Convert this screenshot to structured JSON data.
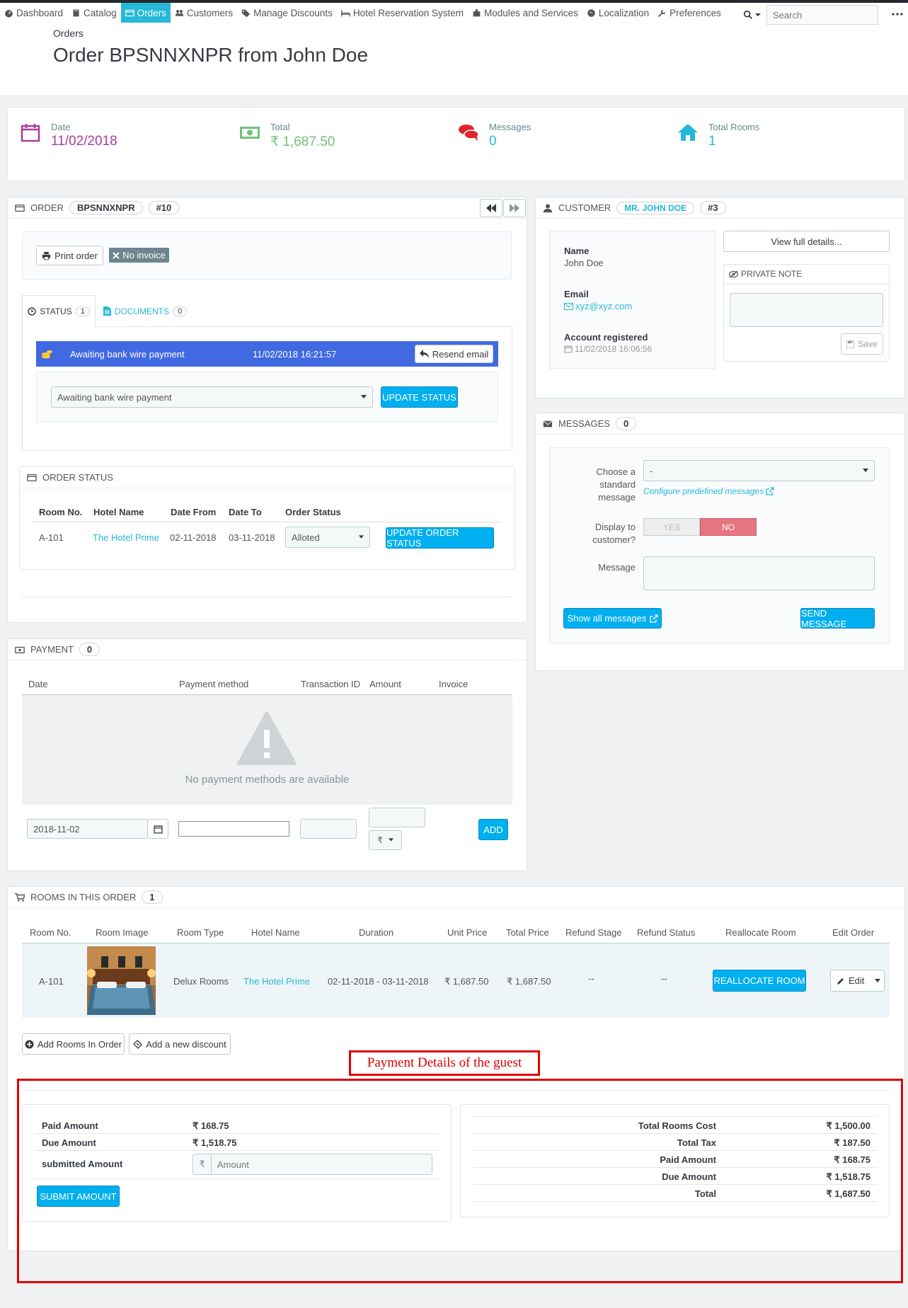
{
  "nav": {
    "items": [
      {
        "label": "Dashboard",
        "icon": "dashboard-icon"
      },
      {
        "label": "Catalog",
        "icon": "book-icon"
      },
      {
        "label": "Orders",
        "icon": "credit-card-icon",
        "active": true
      },
      {
        "label": "Customers",
        "icon": "users-icon"
      },
      {
        "label": "Manage Discounts",
        "icon": "tags-icon"
      },
      {
        "label": "Hotel Reservation System",
        "icon": "bed-icon"
      },
      {
        "label": "Modules and Services",
        "icon": "puzzle-icon"
      },
      {
        "label": "Localization",
        "icon": "globe-icon"
      },
      {
        "label": "Preferences",
        "icon": "wrench-icon"
      }
    ],
    "search_placeholder": "Search"
  },
  "header": {
    "breadcrumb": "Orders",
    "title": "Order BPSNNXNPR from John Doe"
  },
  "kpis": {
    "date": {
      "label": "Date",
      "value": "11/02/2018",
      "color": "#ab3e9d"
    },
    "total": {
      "label": "Total",
      "value": "₹ 1,687.50",
      "color": "#72c279"
    },
    "messages": {
      "label": "Messages",
      "value": "0",
      "color": "#25b9d7"
    },
    "rooms": {
      "label": "Total Rooms",
      "value": "1",
      "color": "#25b9d7"
    }
  },
  "order": {
    "label": "ORDER",
    "reference": "BPSNNXNPR",
    "id": "#10",
    "print_label": "Print order",
    "no_invoice_label": "No invoice",
    "tabs": {
      "status": {
        "label": "STATUS",
        "count": "1"
      },
      "documents": {
        "label": "DOCUMENTS",
        "count": "0"
      }
    },
    "history": {
      "status": "Awaiting bank wire payment",
      "date": "11/02/2018 16:21:57",
      "resend": "Resend email",
      "color": "#4169e1"
    },
    "status_select": "Awaiting bank wire payment",
    "update_status": "UPDATE STATUS"
  },
  "order_status": {
    "title": "ORDER STATUS",
    "columns": [
      "Room No.",
      "Hotel Name",
      "Date From",
      "Date To",
      "Order Status"
    ],
    "row": {
      "room": "A-101",
      "hotel": "The Hotel Prime",
      "from": "02-11-2018",
      "to": "03-11-2018",
      "status": "Alloted"
    },
    "update_button": "UPDATE ORDER STATUS"
  },
  "customer": {
    "label": "CUSTOMER",
    "name_badge": "MR. JOHN DOE",
    "id": "#3",
    "name_label": "Name",
    "name": "John  Doe",
    "email_label": "Email",
    "email": "xyz@xyz.com",
    "registered_label": "Account registered",
    "registered": "11/02/2018 16:06:56",
    "view_details": "View full details...",
    "private_note": "PRIVATE NOTE",
    "save": "Save"
  },
  "messages": {
    "label": "MESSAGES",
    "count": "0",
    "choose_label_1": "Choose a",
    "choose_label_2": "standard",
    "choose_label_3": "message",
    "choose_value": "-",
    "configure": "Configure predefined messages",
    "display_label_1": "Display to",
    "display_label_2": "customer?",
    "yes": "YES",
    "no": "NO",
    "message_label": "Message",
    "show_all": "Show all messages",
    "send": "SEND MESSAGE"
  },
  "payment": {
    "label": "PAYMENT",
    "count": "0",
    "columns": [
      "Date",
      "Payment method",
      "Transaction ID",
      "Amount",
      "Invoice"
    ],
    "empty": "No payment methods are available",
    "date_value": "2018-11-02",
    "currency": "₹",
    "add": "ADD"
  },
  "rooms": {
    "label": "ROOMS IN THIS ORDER",
    "count": "1",
    "columns": [
      "Room No.",
      "Room Image",
      "Room Type",
      "Hotel Name",
      "Duration",
      "Unit Price",
      "Total Price",
      "Refund Stage",
      "Refund Status",
      "Reallocate Room",
      "Edit Order"
    ],
    "row": {
      "room": "A-101",
      "type": "Delux Rooms",
      "hotel": "The Hotel Prime",
      "duration": "02-11-2018 -  03-11-2018",
      "unit": "₹ 1,687.50",
      "total": "₹ 1,687.50",
      "refund_stage": "--",
      "refund_status": "--",
      "reallocate": "REALLOCATE ROOM",
      "edit": "Edit"
    },
    "add_rooms": "Add Rooms In Order",
    "add_discount": "Add a new discount"
  },
  "annotation": {
    "label": "Payment Details of the guest",
    "color": "#e00000"
  },
  "guest_payment": {
    "paid_label": "Paid Amount",
    "paid": "₹ 168.75",
    "due_label": "Due Amount",
    "due": "₹ 1,518.75",
    "submitted_label": "submitted Amount",
    "currency": "₹",
    "amount_placeholder": "Amount",
    "submit": "SUBMIT AMOUNT"
  },
  "totals": [
    {
      "label": "Total Rooms Cost",
      "value": "₹ 1,500.00"
    },
    {
      "label": "Total Tax",
      "value": "₹ 187.50"
    },
    {
      "label": "Paid Amount",
      "value": "₹ 168.75"
    },
    {
      "label": "Due Amount",
      "value": "₹ 1,518.75"
    },
    {
      "label": "Total",
      "value": "₹ 1,687.50"
    }
  ]
}
